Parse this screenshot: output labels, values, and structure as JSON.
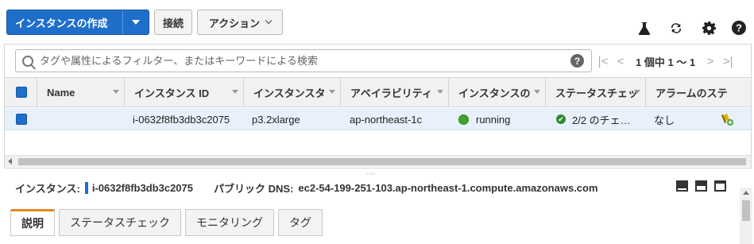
{
  "toolbar": {
    "launch_label": "インスタンスの作成",
    "connect_label": "接続",
    "actions_label": "アクション"
  },
  "top_icons": [
    "flask-icon",
    "refresh-icon",
    "gear-icon",
    "help-icon"
  ],
  "search": {
    "placeholder": "タグや属性によるフィルター、またはキーワードによる検索",
    "help_glyph": "?"
  },
  "pagination": {
    "first": "|<",
    "prev": "<",
    "label": "1 個中 1 ～ 1",
    "next": ">",
    "last": ">|"
  },
  "table": {
    "columns": [
      "Name",
      "インスタンス ID",
      "インスタンスタ",
      "アベイラビリティ",
      "インスタンスの",
      "ステータスチェッ",
      "アラームのステ"
    ],
    "rows": [
      {
        "name": "",
        "instance_id": "i-0632f8fb3db3c2075",
        "instance_type": "p3.2xlarge",
        "az": "ap-northeast-1c",
        "state": "running",
        "status_checks": "2/2 のチェ…",
        "alarm_status": "なし"
      }
    ]
  },
  "detail": {
    "instance_label": "インスタンス:",
    "instance_id": "i-0632f8fb3db3c2075",
    "dns_label": "パブリック DNS:",
    "dns_value": "ec2-54-199-251-103.ap-northeast-1.compute.amazonaws.com",
    "tabs": [
      "説明",
      "ステータスチェック",
      "モニタリング",
      "タグ"
    ],
    "active_tab": "説明"
  },
  "colors": {
    "primary": "#1f6ec9",
    "running": "#3fa12f",
    "selected_row": "#e8f1fb",
    "active_tab": "#e8891c"
  }
}
